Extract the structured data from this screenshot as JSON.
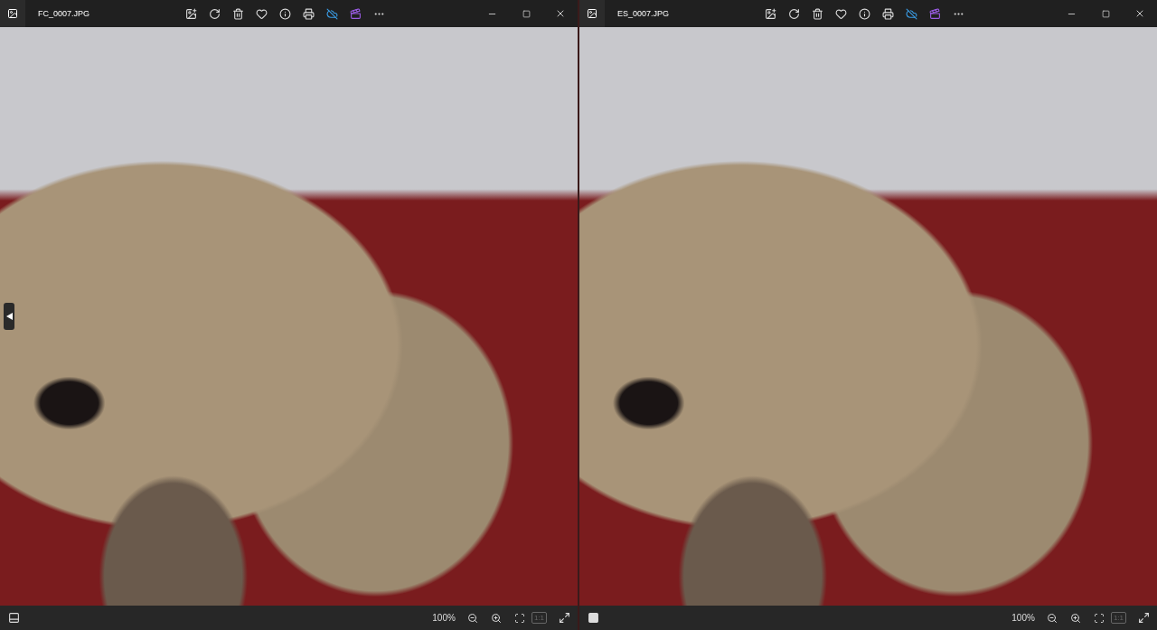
{
  "windows": [
    {
      "title": "FC_0007.JPG",
      "previous_button": true,
      "zoom": "100%",
      "actual_size": {
        "label": "1:1",
        "disabled": true
      },
      "filmstrip": {
        "on": false
      }
    },
    {
      "title": "ES_0007.JPG",
      "previous_button": false,
      "zoom": "100%",
      "actual_size": {
        "label": "1:1",
        "disabled": true
      },
      "filmstrip": {
        "on": true
      }
    }
  ]
}
